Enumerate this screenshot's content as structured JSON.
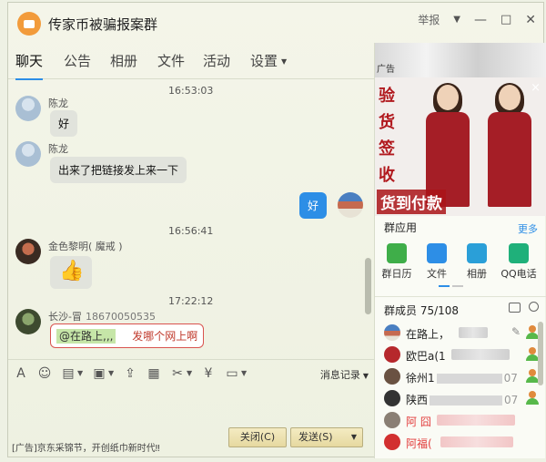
{
  "window": {
    "title": "传家币被骗报案群",
    "report_label": "举报",
    "controls": [
      "chevron-down-icon",
      "minimize-icon",
      "maximize-icon",
      "close-icon"
    ]
  },
  "tabs": [
    {
      "label": "聊天",
      "active": true
    },
    {
      "label": "公告"
    },
    {
      "label": "相册"
    },
    {
      "label": "文件"
    },
    {
      "label": "活动"
    },
    {
      "label": "设置"
    }
  ],
  "messages": {
    "time1": "16:53:03",
    "m1": {
      "sender": "陈龙",
      "text": "好"
    },
    "m2": {
      "sender": "陈龙",
      "text": "出来了把链接发上来一下"
    },
    "m3": {
      "text": "好"
    },
    "time2": "16:56:41",
    "m4": {
      "sender": "金色黎明( 魔戒 )",
      "sticker": "thumbs-up"
    },
    "time3": "17:22:12",
    "m5": {
      "sender": "长沙-冒",
      "phone": "18670050535",
      "at": "@在路上,,,",
      "text": "发哪个网上啊"
    }
  },
  "toolbar": {
    "msg_record": "消息记录"
  },
  "bottom": {
    "ad": "[广告]京东采锦节，开创纸巾新时代‼",
    "close_label": "关闭(C)",
    "send_label": "发送(S)"
  },
  "ad_panel": {
    "top_label": "广告",
    "vertical_text": "验货签收",
    "bottom_text": "货到付款",
    "close": "×"
  },
  "group_apps": {
    "title": "群应用",
    "more": "更多",
    "apps": [
      {
        "label": "群日历",
        "color": "#3fae49"
      },
      {
        "label": "文件",
        "color": "#2d8ee6"
      },
      {
        "label": "相册",
        "color": "#2a9fd8"
      },
      {
        "label": "QQ电话",
        "color": "#1fb07a"
      }
    ]
  },
  "members": {
    "title": "群成员 75/108",
    "list": [
      {
        "name": "在路上，",
        "name_color": "#222"
      },
      {
        "name": "欧巴a(1",
        "name_color": "#222"
      },
      {
        "name": "徐州1",
        "suffix": "07",
        "name_color": "#222"
      },
      {
        "name": "陕西",
        "suffix": "07",
        "name_color": "#222"
      },
      {
        "name": "阿 囧",
        "name_color": "#e23c3c"
      },
      {
        "name": "阿福(",
        "name_color": "#e23c3c"
      }
    ]
  }
}
